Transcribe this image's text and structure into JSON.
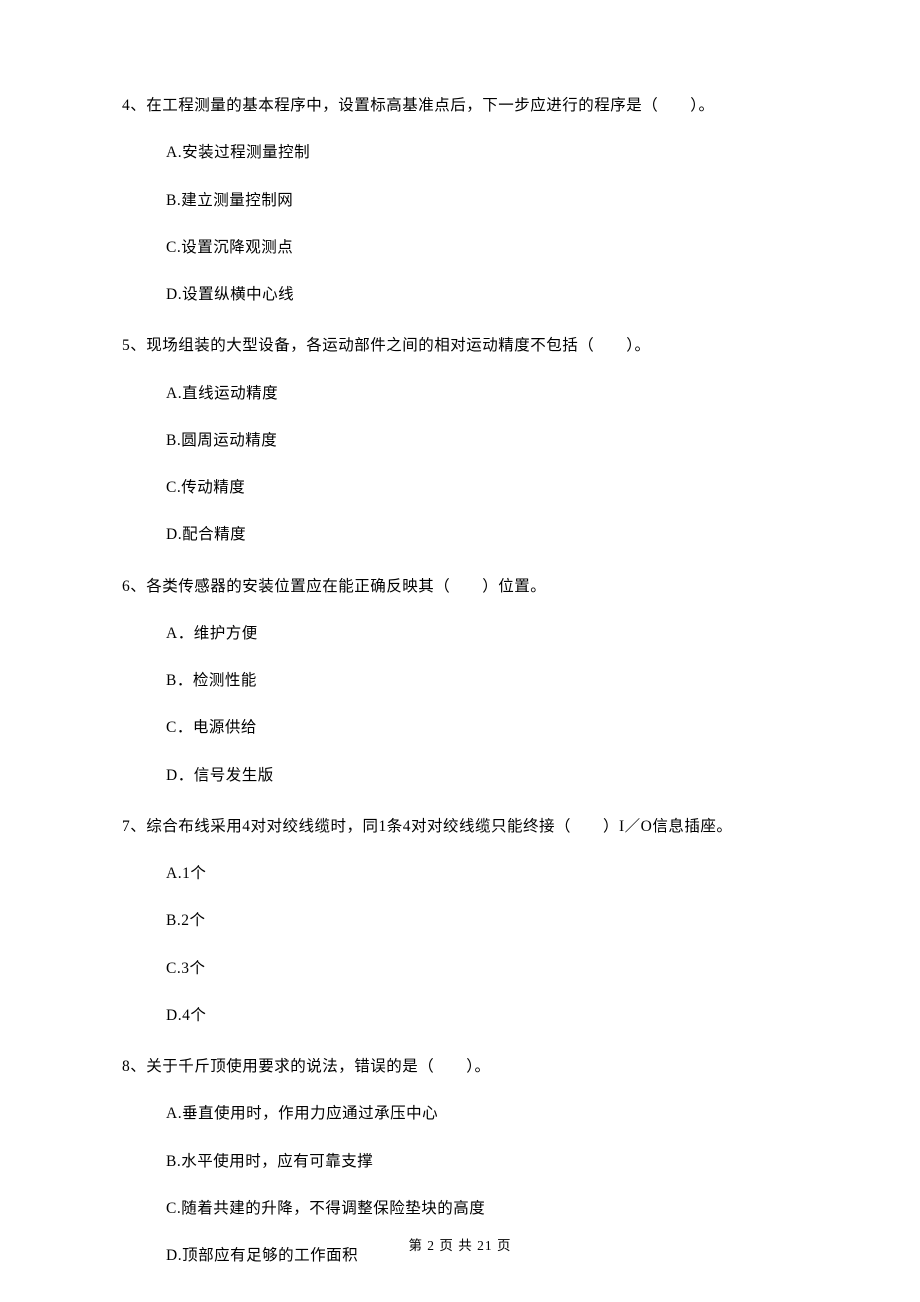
{
  "questions": [
    {
      "stem": "4、在工程测量的基本程序中，设置标高基准点后，下一步应进行的程序是（　　）。",
      "options": [
        "A.安装过程测量控制",
        "B.建立测量控制网",
        "C.设置沉降观测点",
        "D.设置纵横中心线"
      ]
    },
    {
      "stem": "5、现场组装的大型设备，各运动部件之间的相对运动精度不包括（　　）。",
      "options": [
        "A.直线运动精度",
        "B.圆周运动精度",
        "C.传动精度",
        "D.配合精度"
      ]
    },
    {
      "stem": "6、各类传感器的安装位置应在能正确反映其（　　）位置。",
      "options": [
        "A．维护方便",
        "B．检测性能",
        "C．电源供给",
        "D．信号发生版"
      ]
    },
    {
      "stem": "7、综合布线采用4对对绞线缆时，同1条4对对绞线缆只能终接（　　）I／O信息插座。",
      "options": [
        "A.1个",
        "B.2个",
        "C.3个",
        "D.4个"
      ]
    },
    {
      "stem": "8、关于千斤顶使用要求的说法，错误的是（　　）。",
      "options": [
        "A.垂直使用时，作用力应通过承压中心",
        "B.水平使用时，应有可靠支撑",
        "C.随着共建的升降，不得调整保险垫块的高度",
        "D.顶部应有足够的工作面积"
      ]
    }
  ],
  "footer": "第 2 页 共 21 页"
}
